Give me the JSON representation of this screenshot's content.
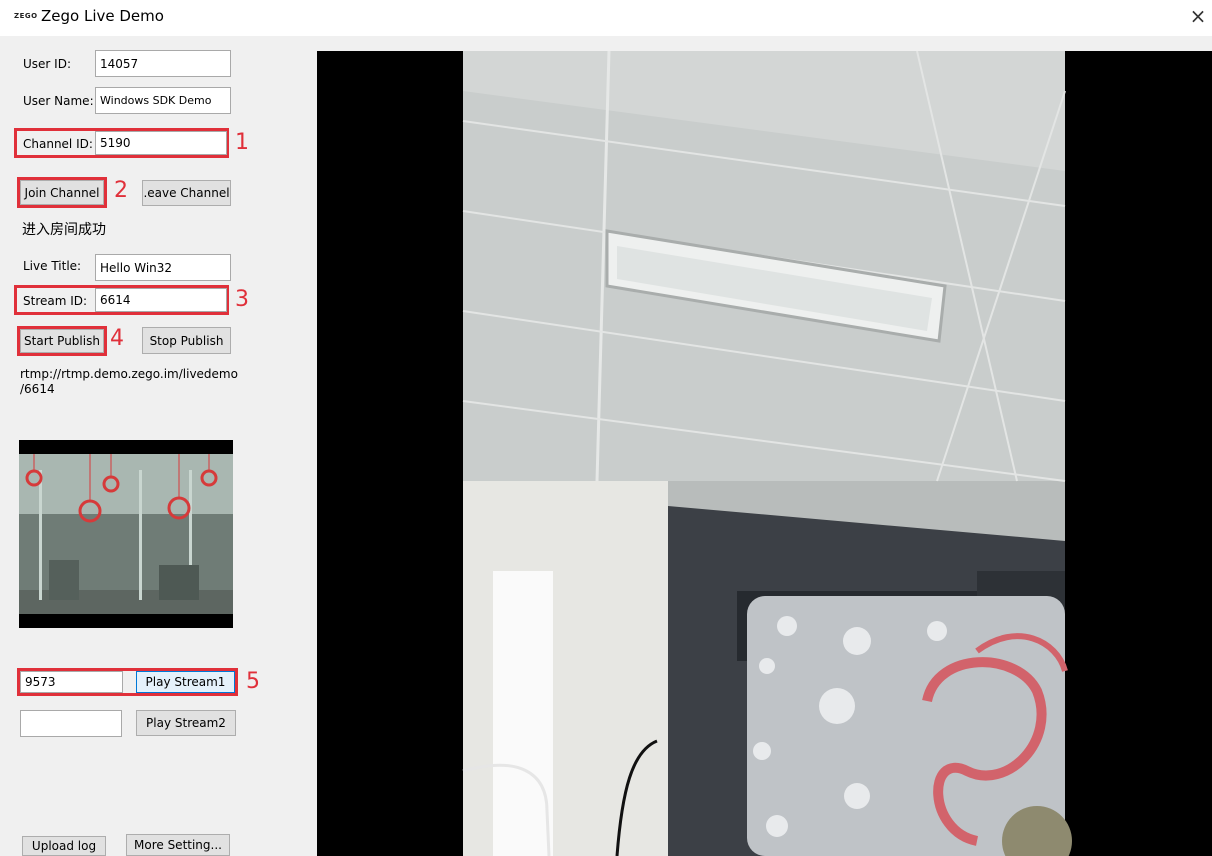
{
  "window": {
    "logo_text": "ZEGO",
    "title": "Zego Live Demo",
    "close_glyph": "×"
  },
  "form": {
    "user_id_label": "User ID:",
    "user_id_value": "14057",
    "user_name_label": "User Name:",
    "user_name_value": "Windows SDK Demo",
    "channel_id_label": "Channel ID:",
    "channel_id_value": "5190",
    "join_channel_label": "Join Channel",
    "leave_channel_label": ".eave Channel",
    "room_status": "进入房间成功",
    "live_title_label": "Live Title:",
    "live_title_value": "Hello Win32",
    "stream_id_label": "Stream ID:",
    "stream_id_value": "6614",
    "start_publish_label": "Start Publish",
    "stop_publish_label": "Stop Publish",
    "rtmp_url_line1": "rtmp://rtmp.demo.zego.im/livedemo",
    "rtmp_url_line2": "/6614"
  },
  "play": {
    "stream1_value": "9573",
    "stream1_button": "Play Stream1",
    "stream2_value": "",
    "stream2_button": "Play Stream2"
  },
  "footer": {
    "upload_log_label": "Upload log",
    "more_setting_label": "More Setting..."
  },
  "annotations": {
    "n1": "1",
    "n2": "2",
    "n3": "3",
    "n4": "4",
    "n5": "5"
  },
  "colors": {
    "highlight": "#e0303a",
    "focus": "#0078d7",
    "window_bg": "#f0f0f0"
  }
}
